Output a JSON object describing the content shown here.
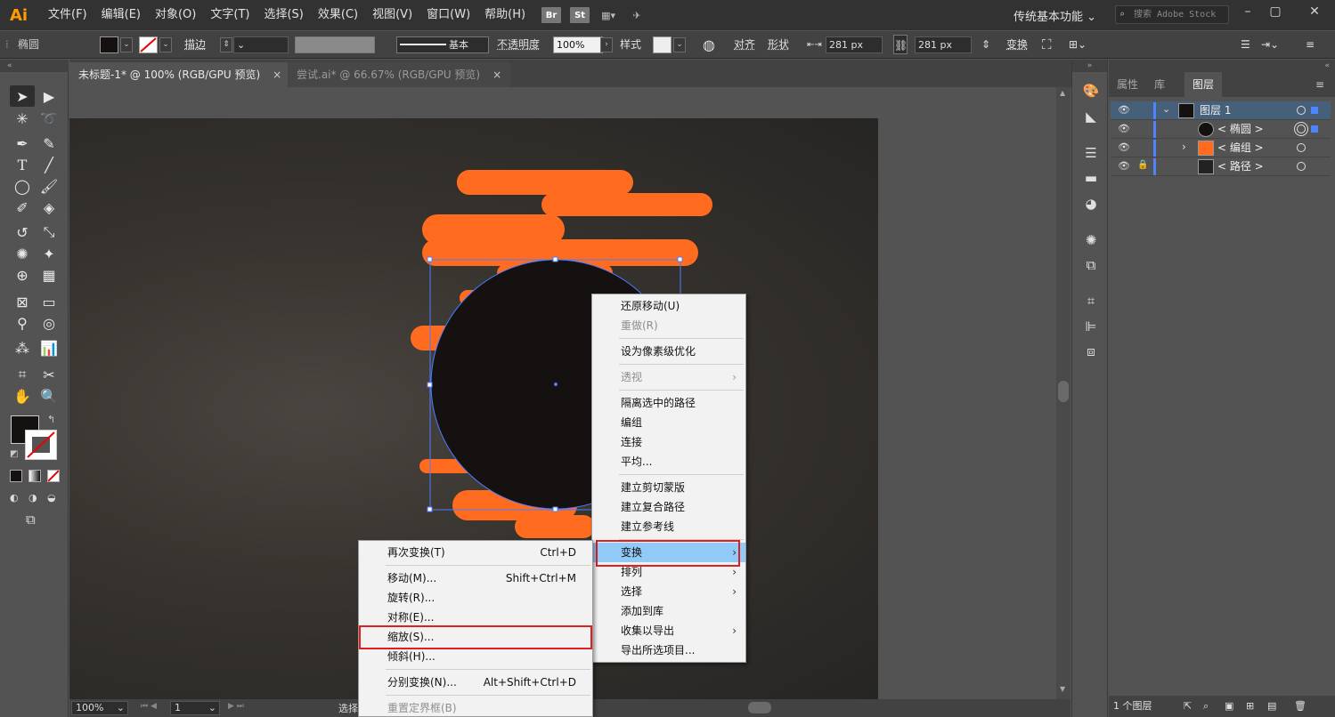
{
  "app": {
    "logo": "Ai",
    "menus": [
      "文件(F)",
      "编辑(E)",
      "对象(O)",
      "文字(T)",
      "选择(S)",
      "效果(C)",
      "视图(V)",
      "窗口(W)",
      "帮助(H)"
    ],
    "bridge": "Br",
    "stock": "St",
    "workspace": "传统基本功能",
    "search_placeholder": "搜索 Adobe Stock"
  },
  "control": {
    "object_type": "椭圆",
    "stroke_label": "描边",
    "brush_label": "基本",
    "opacity_label": "不透明度",
    "opacity_value": "100%",
    "style_label": "样式",
    "align_label": "对齐",
    "shape_label": "形状",
    "width_value": "281 px",
    "height_value": "281 px",
    "transform_label": "变换"
  },
  "tabs": [
    {
      "label": "未标题-1* @ 100% (RGB/GPU 预览)",
      "close": "×"
    },
    {
      "label": "尝试.ai* @ 66.67% (RGB/GPU 预览)",
      "close": "×"
    }
  ],
  "context_menu": {
    "items": [
      {
        "label": "还原移动(U)",
        "disabled": false
      },
      {
        "label": "重做(R)",
        "disabled": true
      },
      {
        "label": "设为像素级优化",
        "disabled": false
      },
      {
        "label": "透视",
        "disabled": true,
        "submenu": true
      },
      {
        "label": "隔离选中的路径",
        "disabled": false
      },
      {
        "label": "编组",
        "disabled": false
      },
      {
        "label": "连接",
        "disabled": false
      },
      {
        "label": "平均...",
        "disabled": false
      },
      {
        "label": "建立剪切蒙版",
        "disabled": false
      },
      {
        "label": "建立复合路径",
        "disabled": false
      },
      {
        "label": "建立参考线",
        "disabled": false
      },
      {
        "label": "变换",
        "disabled": false,
        "submenu": true,
        "highlighted": true
      },
      {
        "label": "排列",
        "disabled": false,
        "submenu": true
      },
      {
        "label": "选择",
        "disabled": false,
        "submenu": true
      },
      {
        "label": "添加到库",
        "disabled": false
      },
      {
        "label": "收集以导出",
        "disabled": false,
        "submenu": true
      },
      {
        "label": "导出所选项目...",
        "disabled": false
      }
    ]
  },
  "transform_submenu": {
    "items": [
      {
        "label": "再次变换(T)",
        "shortcut": "Ctrl+D"
      },
      {
        "label": "移动(M)...",
        "shortcut": "Shift+Ctrl+M"
      },
      {
        "label": "旋转(R)...",
        "shortcut": ""
      },
      {
        "label": "对称(E)...",
        "shortcut": ""
      },
      {
        "label": "缩放(S)...",
        "shortcut": "",
        "boxed": true
      },
      {
        "label": "倾斜(H)...",
        "shortcut": ""
      },
      {
        "label": "分别变换(N)...",
        "shortcut": "Alt+Shift+Ctrl+D"
      },
      {
        "label": "重置定界框(B)",
        "shortcut": "",
        "disabled": true
      }
    ]
  },
  "status": {
    "zoom": "100%",
    "artboard": "1",
    "tool": "选择"
  },
  "panel": {
    "tabs": [
      "属性",
      "库",
      "图层"
    ],
    "active_tab": "图层",
    "layers": [
      {
        "name": "图层 1",
        "level": 0,
        "expanded": true,
        "selected": true
      },
      {
        "name": "< 椭圆 >",
        "level": 1
      },
      {
        "name": "< 编组 >",
        "level": 1,
        "collapsed": true
      },
      {
        "name": "< 路径 >",
        "level": 1,
        "locked": true
      }
    ],
    "footer": "1 个图层"
  },
  "colors": {
    "accent_orange": "#ff6b1f",
    "circle_fill": "#151111",
    "selection_blue": "#4f7cff",
    "menu_highlight": "#91c9f7",
    "annotation_red": "#e02020"
  }
}
